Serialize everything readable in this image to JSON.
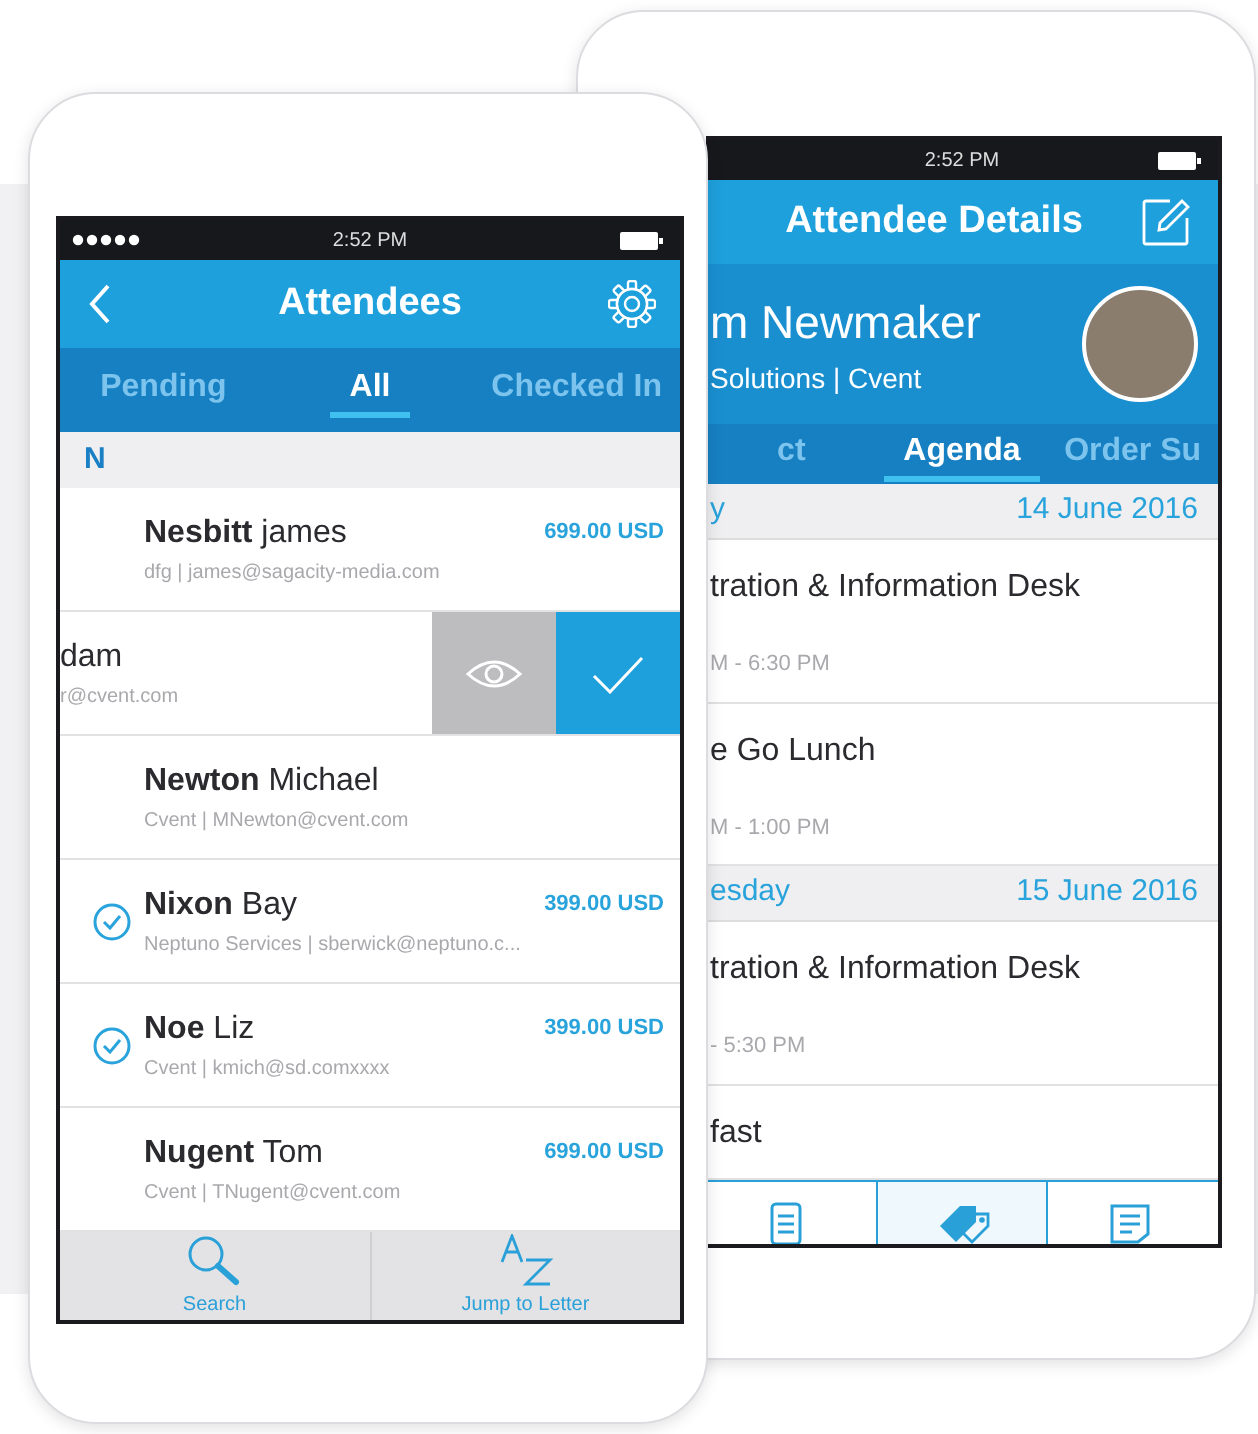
{
  "front_phone": {
    "status_bar": {
      "time": "2:52 PM"
    },
    "header": {
      "title": "Attendees"
    },
    "tabs": [
      {
        "label": "Pending",
        "selected": false
      },
      {
        "label": "All",
        "selected": true
      },
      {
        "label": "Checked In",
        "selected": false
      }
    ],
    "section": "N",
    "attendees": [
      {
        "kind": "row",
        "last": "Nesbitt",
        "first": "james",
        "detail": "dfg | james@sagacity-media.com",
        "price": "699.00 USD",
        "checked_in": false
      },
      {
        "kind": "swiped",
        "first": "dam",
        "detail": "r@cvent.com"
      },
      {
        "kind": "row",
        "last": "Newton",
        "first": "Michael",
        "detail": "Cvent | MNewton@cvent.com",
        "checked_in": false
      },
      {
        "kind": "row",
        "last": "Nixon",
        "first": "Bay",
        "detail": "Neptuno Services | sberwick@neptuno.c...",
        "price": "399.00 USD",
        "checked_in": true
      },
      {
        "kind": "row",
        "last": "Noe",
        "first": "Liz",
        "detail": "Cvent | kmich@sd.comxxxx",
        "price": "399.00 USD",
        "checked_in": true
      },
      {
        "kind": "row",
        "last": "Nugent",
        "first": "Tom",
        "detail": "Cvent | TNugent@cvent.com",
        "price": "699.00 USD",
        "checked_in": false
      }
    ],
    "toolbar": [
      {
        "kind": "search",
        "label": "Search"
      },
      {
        "kind": "az",
        "label": "Jump to Letter"
      }
    ]
  },
  "back_phone": {
    "status_bar": {
      "time": "2:52 PM"
    },
    "header": {
      "title": "Attendee Details"
    },
    "profile": {
      "name": "m Newmaker",
      "company": "Solutions | Cvent"
    },
    "tabs": [
      {
        "label": "ct",
        "selected": false
      },
      {
        "label": "Agenda",
        "selected": true
      },
      {
        "label": "Order Su",
        "selected": false
      }
    ],
    "days": [
      {
        "day": "y",
        "date": "14 June 2016",
        "sessions": [
          {
            "title": "tration & Information Desk",
            "time": "M - 6:30 PM"
          },
          {
            "title": "e Go Lunch",
            "time": "M - 1:00 PM"
          }
        ]
      },
      {
        "day": "esday",
        "date": "15 June 2016",
        "sessions": [
          {
            "title": "tration & Information Desk",
            "time": "- 5:30 PM"
          },
          {
            "title": "fast"
          }
        ]
      }
    ],
    "bottom_tabs": [
      {
        "selected": false
      },
      {
        "selected": true
      },
      {
        "selected": false
      }
    ]
  }
}
